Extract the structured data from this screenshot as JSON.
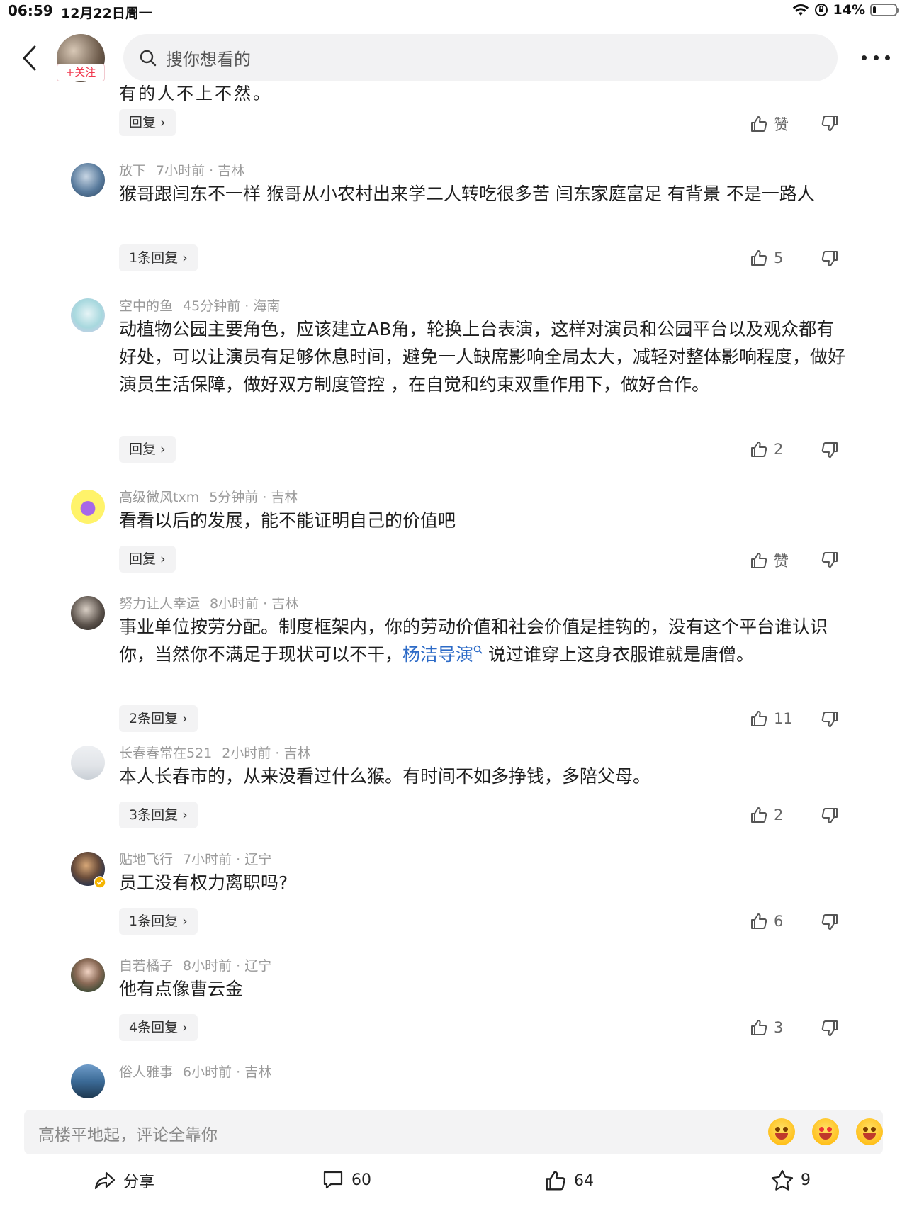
{
  "status_bar": {
    "time": "06:59",
    "date": "12月22日周一",
    "battery": "14%",
    "battery_level": 0.14
  },
  "header": {
    "follow_label": "+关注",
    "search_placeholder": "搜你想看的"
  },
  "partial_top_text": "有的人不上不然。",
  "first_reply_label": "回复",
  "first_like_label": "赞",
  "comments": [
    {
      "user": "放下",
      "time": "7小时前",
      "location": "吉林",
      "text": "猴哥跟闫东不一样 猴哥从小农村出来学二人转吃很多苦 闫东家庭富足 有背景 不是一路人",
      "replies": "1条回复",
      "likes": "5"
    },
    {
      "user": "空中的鱼",
      "time": "45分钟前",
      "location": "海南",
      "text": "动植物公园主要角色，应该建立AB角，轮换上台表演，这样对演员和公园平台以及观众都有好处，可以让演员有足够休息时间，避免一人缺席影响全局太大，减轻对整体影响程度，做好演员生活保障，做好双方制度管控 ，在自觉和约束双重作用下，做好合作。",
      "replies": "回复",
      "likes": "2"
    },
    {
      "user": "高级微风txm",
      "time": "5分钟前",
      "location": "吉林",
      "text": "看看以后的发展，能不能证明自己的价值吧",
      "replies": "回复",
      "likes": "赞"
    },
    {
      "user": "努力让人幸运",
      "time": "8小时前",
      "location": "吉林",
      "text_before": "事业单位按劳分配。制度框架内，你的劳动价值和社会价值是挂钩的，没有这个平台谁认识你，当然你不满足于现状可以不干，",
      "mention": "杨洁导演",
      "text_after": " 说过谁穿上这身衣服谁就是唐僧。",
      "replies": "2条回复",
      "likes": "11"
    },
    {
      "user": "长春春常在521",
      "time": "2小时前",
      "location": "吉林",
      "text": "本人长春市的，从来没看过什么猴。有时间不如多挣钱，多陪父母。",
      "replies": "3条回复",
      "likes": "2"
    },
    {
      "user": "贴地飞行",
      "time": "7小时前",
      "location": "辽宁",
      "text": "员工没有权力离职吗?",
      "replies": "1条回复",
      "likes": "6"
    },
    {
      "user": "自若橘子",
      "time": "8小时前",
      "location": "辽宁",
      "text": "他有点像曹云金",
      "replies": "4条回复",
      "likes": "3"
    },
    {
      "user": "俗人雅事",
      "time": "6小时前",
      "location": "吉林"
    }
  ],
  "input": {
    "placeholder": "高楼平地起，评论全靠你"
  },
  "bottom_nav": {
    "share_label": "分享",
    "comments_count": "60",
    "likes_count": "64",
    "favorites_count": "9"
  },
  "colors": {
    "accent_red": "#f0394f",
    "mention_blue": "#2d6bc7",
    "meta_gray": "#9a9a9a"
  }
}
